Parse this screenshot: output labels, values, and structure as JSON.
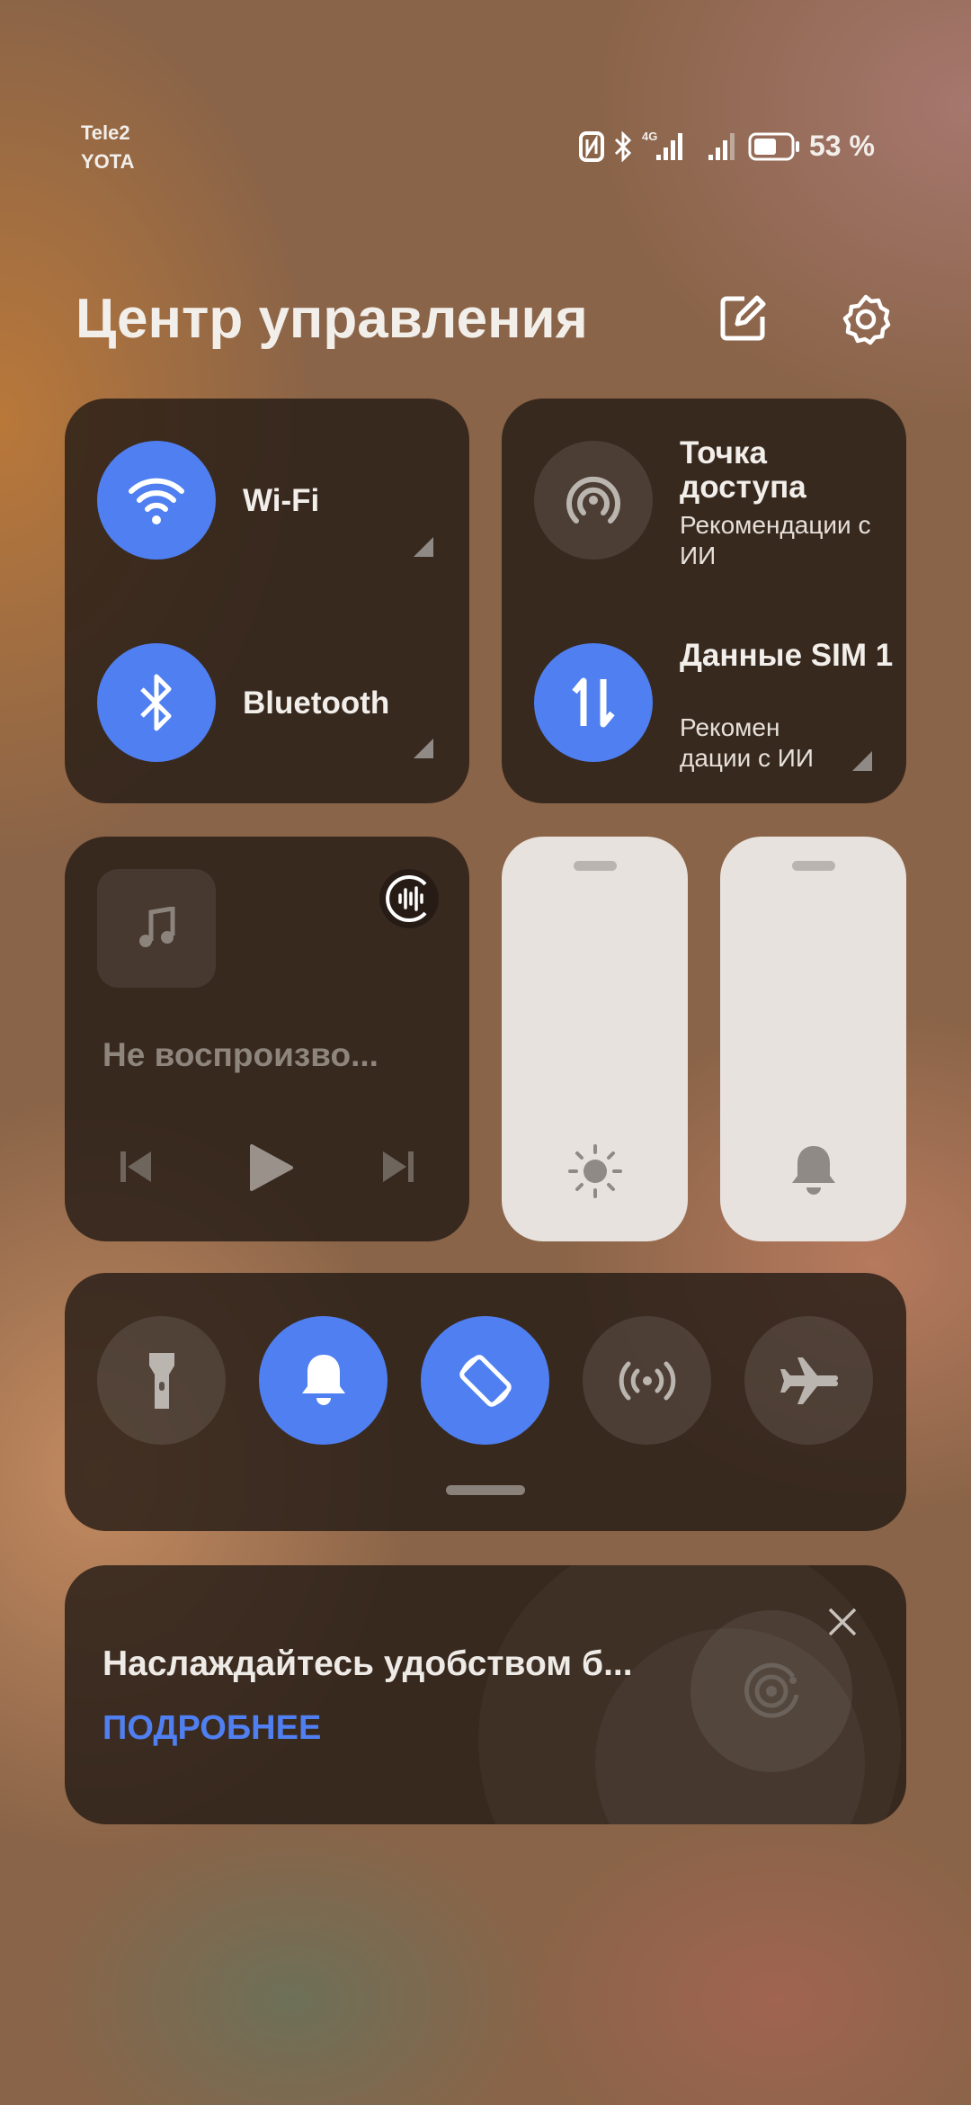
{
  "status_bar": {
    "carrier1": "Tele2",
    "carrier2": "YOTA",
    "network": "4G",
    "battery_percent": "53 %",
    "battery_level": 53,
    "icons": [
      "nfc-icon",
      "bluetooth-icon",
      "signal-icon",
      "signal-icon",
      "battery-icon"
    ]
  },
  "header": {
    "title": "Центр управления",
    "edit_icon": "edit-icon",
    "settings_icon": "gear-icon"
  },
  "connectivity": {
    "wifi": {
      "label": "Wi-Fi",
      "active": true
    },
    "bluetooth": {
      "label": "Bluetooth",
      "active": true
    },
    "hotspot": {
      "label": "Точка доступа",
      "sub": "Рекомендации с ИИ",
      "active": false
    },
    "data": {
      "label": "Данные SIM 1",
      "sub": "Рекомен дации с ИИ",
      "active": true
    }
  },
  "media": {
    "title": "Не воспроизво..."
  },
  "sliders": {
    "brightness_icon": "sun-icon",
    "volume_icon": "bell-icon"
  },
  "toggles": [
    {
      "name": "flashlight",
      "icon": "flashlight-icon",
      "active": false
    },
    {
      "name": "ringer",
      "icon": "bell-icon",
      "active": true
    },
    {
      "name": "auto-rotate",
      "icon": "rotate-icon",
      "active": true
    },
    {
      "name": "nfc-signal",
      "icon": "broadcast-icon",
      "active": false
    },
    {
      "name": "airplane",
      "icon": "airplane-icon",
      "active": false
    }
  ],
  "banner": {
    "text": "Наслаждайтесь удобством б...",
    "link": "ПОДРОБНЕЕ"
  },
  "colors": {
    "accent": "#4f7ff0",
    "tile": "#261c16",
    "slider": "#e7e2de"
  }
}
